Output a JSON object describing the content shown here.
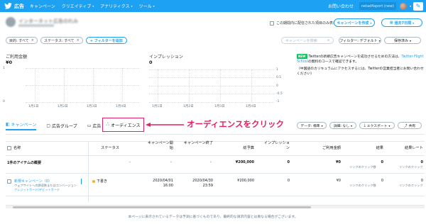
{
  "topbar": {
    "brand": "広告",
    "nav": [
      {
        "label": "キャンペーン",
        "has_caret": false
      },
      {
        "label": "クリエイティブ",
        "has_caret": true
      },
      {
        "label": "アナリティクス",
        "has_caret": true
      },
      {
        "label": "ツール",
        "has_caret": true
      }
    ],
    "help": "お問い合わせ",
    "account_label": "netad4sport (new)",
    "caret": "▾",
    "compose_icon": "✎"
  },
  "account": {
    "name": "インターネット広告のれみ",
    "blurred": true
  },
  "controls": {
    "hidden_check_label": "この期間内に配信された項目のみ表示",
    "create_campaign": "キャンペーンを作成",
    "date_range": "過去7日間"
  },
  "filters": {
    "chips": [
      {
        "label": "目的: すべて",
        "remove": "×"
      },
      {
        "label": "ステータス: すべて",
        "remove": "×"
      }
    ],
    "add_filter": "+ フィルターを追加",
    "search_placeholder": "キャンペーンを検索",
    "search_icon": "⌕",
    "filter_default": "フィルター: デフォルト",
    "save": "保存済み"
  },
  "metrics": [
    {
      "title": "ご利用金額",
      "value": "¥0",
      "y_ticks": [
        "1",
        "0"
      ],
      "x_ticks": [
        "1月1日",
        "1月2日",
        "1月3日",
        "1月4日"
      ]
    },
    {
      "title": "インプレッション",
      "value": "0",
      "y_ticks": [
        "1",
        "0.5",
        "0",
        "-0.5",
        "-1"
      ],
      "x_ticks": [
        "1月1日",
        "1月2日",
        "1月3日",
        "1月4日"
      ]
    }
  ],
  "notice": {
    "badge": "NEW",
    "text1": "Twitterの新規広告キャンペーンを成功させるための方法は、",
    "link": "Twitter Flight School",
    "text2": "の無料のコースで確認できます。",
    "text3": "（中国語のカリキュラムにアクセスするには、Twitterの営業担当者にお問い合わせください）"
  },
  "tabs": [
    {
      "label": "キャンペーン",
      "icon": "◧",
      "icon_name": "campaign-icon",
      "active": true
    },
    {
      "label": "広告グループ",
      "icon": "▢",
      "icon_name": "ad-group-icon",
      "active": false
    },
    {
      "label": "広告",
      "icon": "▭",
      "icon_name": "ad-icon",
      "active": false
    },
    {
      "label": "オーディエンス",
      "icon": "ஃ",
      "icon_name": "audience-icon",
      "active": false
    }
  ],
  "annotation": {
    "text": "オーディエンスをクリック",
    "color": "#e0245e"
  },
  "toolbar": {
    "data": "データ: 標準",
    "breakdown": "詳細: なし",
    "export": "エクスポート",
    "share": "共有",
    "caret": "▾",
    "export_icon": "⤓",
    "share_icon": "⤴"
  },
  "table": {
    "headers": [
      "名称",
      "ステータス",
      "キャンペーン開始",
      "キャンペーン終了",
      "総予算",
      "インプレッション",
      "ご利用金額",
      "結果",
      "結果レート"
    ],
    "summary": {
      "name": "1件のアイテムの概要",
      "status": "-",
      "start": "-",
      "end": "-",
      "budget": "¥200,000",
      "impressions": "0",
      "spend": "¥0",
      "results": "0",
      "results_sub": "リンクのクリック数",
      "rate": "0",
      "rate_sub": "リンクのクリック"
    },
    "rows": [
      {
        "name": "新規キャンペーン（0）",
        "sub1": "ウェブサイトへの誘導数またはコンバージョン",
        "sub2": "クレジットカード/デビットカード",
        "status": "下書き",
        "start": "2020/04/01",
        "start_time": "16:00",
        "end": "2020/04/30",
        "end_time": "23:59",
        "budget": "¥200,000",
        "impressions": "0",
        "spend": "¥0",
        "results": "0",
        "results_sub": "リンクのクリック数",
        "rate": "0",
        "rate_sub": "リンクのクリック"
      }
    ]
  },
  "disclaimer": "本ページに表示されているデータは予測に基づくものであり、最終的な請求内容とは異なる場合がございます。",
  "colors": {
    "brand": "#1da1f2",
    "highlight": "#e0245e",
    "draft_status": "#ffad1f"
  }
}
